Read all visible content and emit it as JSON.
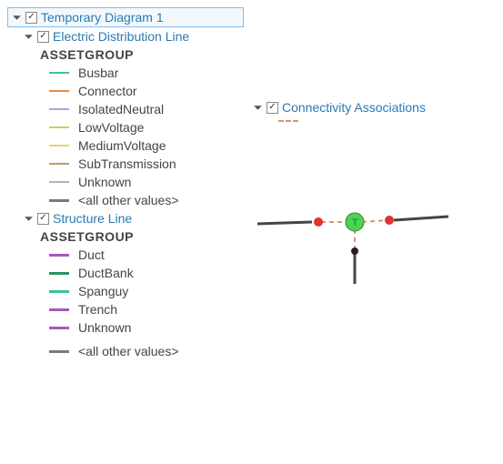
{
  "root": {
    "label": "Temporary Diagram 1",
    "checked": "✓"
  },
  "layers": {
    "edl": {
      "label": "Electric Distribution Line",
      "checked": "✓",
      "group_heading": "ASSETGROUP",
      "items": [
        {
          "label": "Busbar",
          "color": "#3fbfa5"
        },
        {
          "label": "Connector",
          "color": "#e88c3a"
        },
        {
          "label": "IsolatedNeutral",
          "color": "#a9a4e0"
        },
        {
          "label": "LowVoltage",
          "color": "#b7d66b"
        },
        {
          "label": "MediumVoltage",
          "color": "#e6d36a"
        },
        {
          "label": "SubTransmission",
          "color": "#b89b6a"
        },
        {
          "label": "Unknown",
          "color": "#b3b3b3"
        }
      ],
      "other_label": "<all other values>",
      "other_color": "#7a7a7a"
    },
    "sl": {
      "label": "Structure Line",
      "checked": "✓",
      "group_heading": "ASSETGROUP",
      "items": [
        {
          "label": "Duct",
          "color": "#a955c2"
        },
        {
          "label": "DuctBank",
          "color": "#2f915f"
        },
        {
          "label": "Spanguy",
          "color": "#37c29a"
        },
        {
          "label": "Trench",
          "color": "#a955c2"
        },
        {
          "label": "Unknown",
          "color": "#a955c2"
        }
      ],
      "other_label": "<all other values>",
      "other_color": "#7a7a7a"
    }
  },
  "right": {
    "label": "Connectivity Associations",
    "checked": "✓"
  },
  "glyphs": {
    "check": "✓",
    "node_letter": "T"
  }
}
